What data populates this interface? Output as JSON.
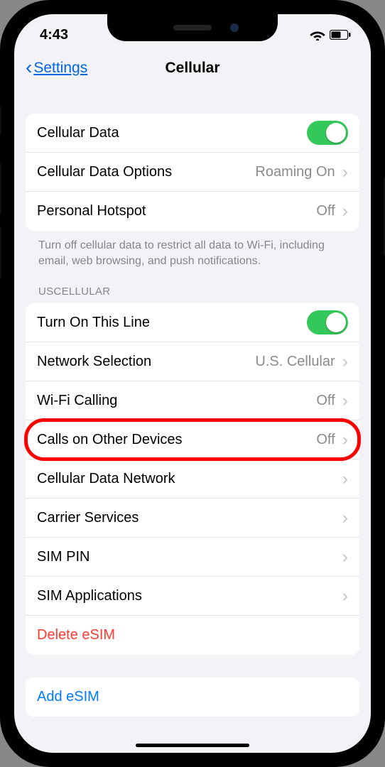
{
  "statusbar": {
    "time": "4:43"
  },
  "nav": {
    "back_label": "Settings",
    "title": "Cellular"
  },
  "group1": {
    "items": [
      {
        "label": "Cellular Data",
        "control": "toggle"
      },
      {
        "label": "Cellular Data Options",
        "value": "Roaming On",
        "chevron": true
      },
      {
        "label": "Personal Hotspot",
        "value": "Off",
        "chevron": true
      }
    ],
    "footer": "Turn off cellular data to restrict all data to Wi-Fi, including email, web browsing, and push notifications."
  },
  "section2_header": "USCELLULAR",
  "group2": {
    "items": [
      {
        "label": "Turn On This Line",
        "control": "toggle"
      },
      {
        "label": "Network Selection",
        "value": "U.S. Cellular",
        "chevron": true
      },
      {
        "label": "Wi-Fi Calling",
        "value": "Off",
        "chevron": true
      },
      {
        "label": "Calls on Other Devices",
        "value": "Off",
        "chevron": true
      },
      {
        "label": "Cellular Data Network",
        "chevron": true
      },
      {
        "label": "Carrier Services",
        "chevron": true
      },
      {
        "label": "SIM PIN",
        "chevron": true
      },
      {
        "label": "SIM Applications",
        "chevron": true
      },
      {
        "label": "Delete eSIM",
        "danger": true
      }
    ]
  },
  "group3": {
    "items": [
      {
        "label": "Add eSIM",
        "link": true
      }
    ]
  },
  "highlighted_index": 2
}
